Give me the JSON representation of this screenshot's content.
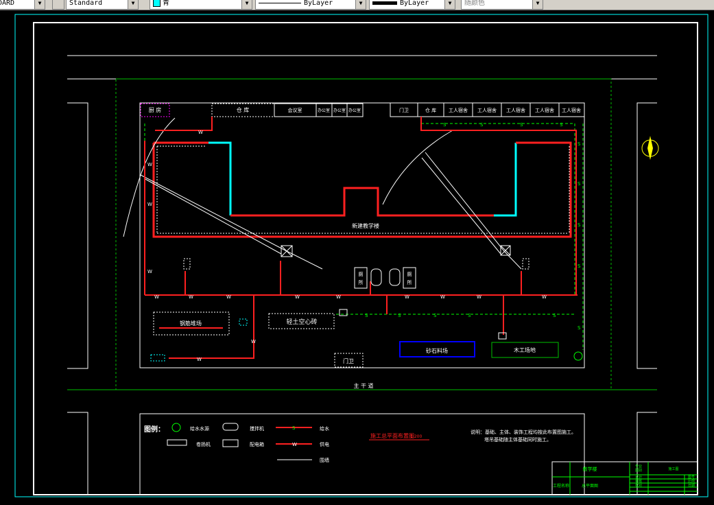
{
  "toolbar": {
    "layer_partial": "DARD",
    "text_style": "Standard",
    "color": "青",
    "linetype": "ByLayer",
    "lineweight": "ByLayer",
    "plot_style": "随颜色",
    "colors": {
      "face": "#d4d0c8",
      "cyan": "#00ffff"
    }
  },
  "drawing": {
    "rooms_left": [
      "厨 房",
      "仓 库",
      "会议室",
      "办公室",
      "办公室",
      "办公室"
    ],
    "rooms_right": [
      "门卫",
      "仓 库",
      "工人宿舍",
      "工人宿舍",
      "工人宿舍",
      "工人宿舍",
      "工人宿舍"
    ],
    "building_label": "新建教学楼",
    "area_steel": "钢筋堆场",
    "area_block": "轻土空心砖",
    "area_sand": "砂石料场",
    "area_wood": "木工场地",
    "gate": "门卫",
    "toilet": "厕",
    "toilet2": "所",
    "road_label": "主 干 道",
    "water_mark": "W",
    "sewer_mark": "S",
    "legend_title": "图例：",
    "legend_items": [
      "给水水源",
      "搅拌机",
      "给水",
      "卷扬机",
      "配电箱",
      "供电",
      "围墙"
    ],
    "plan_title": "施工总平面布置图",
    "plan_scale": "1:200",
    "notes_line1": "说明：基础、主体、装饰工程均按此布置图施工。",
    "notes_line2": "塔吊基础随主体基础同时施工。",
    "title_block": {
      "project": "教学楼",
      "drawing": "总平面图",
      "cells": [
        "设计",
        "审核",
        "校对",
        "图号",
        "比例",
        "日期",
        "施工图",
        "专业",
        "图别"
      ],
      "row_label": "工程名称"
    },
    "colors": {
      "water": "#ff2020",
      "sewer": "#00ff00",
      "frame": "#ffffff",
      "cyan": "#00ffff",
      "magenta": "#ff00ff",
      "yellow": "#ffff00",
      "blue": "#0000ff"
    }
  }
}
